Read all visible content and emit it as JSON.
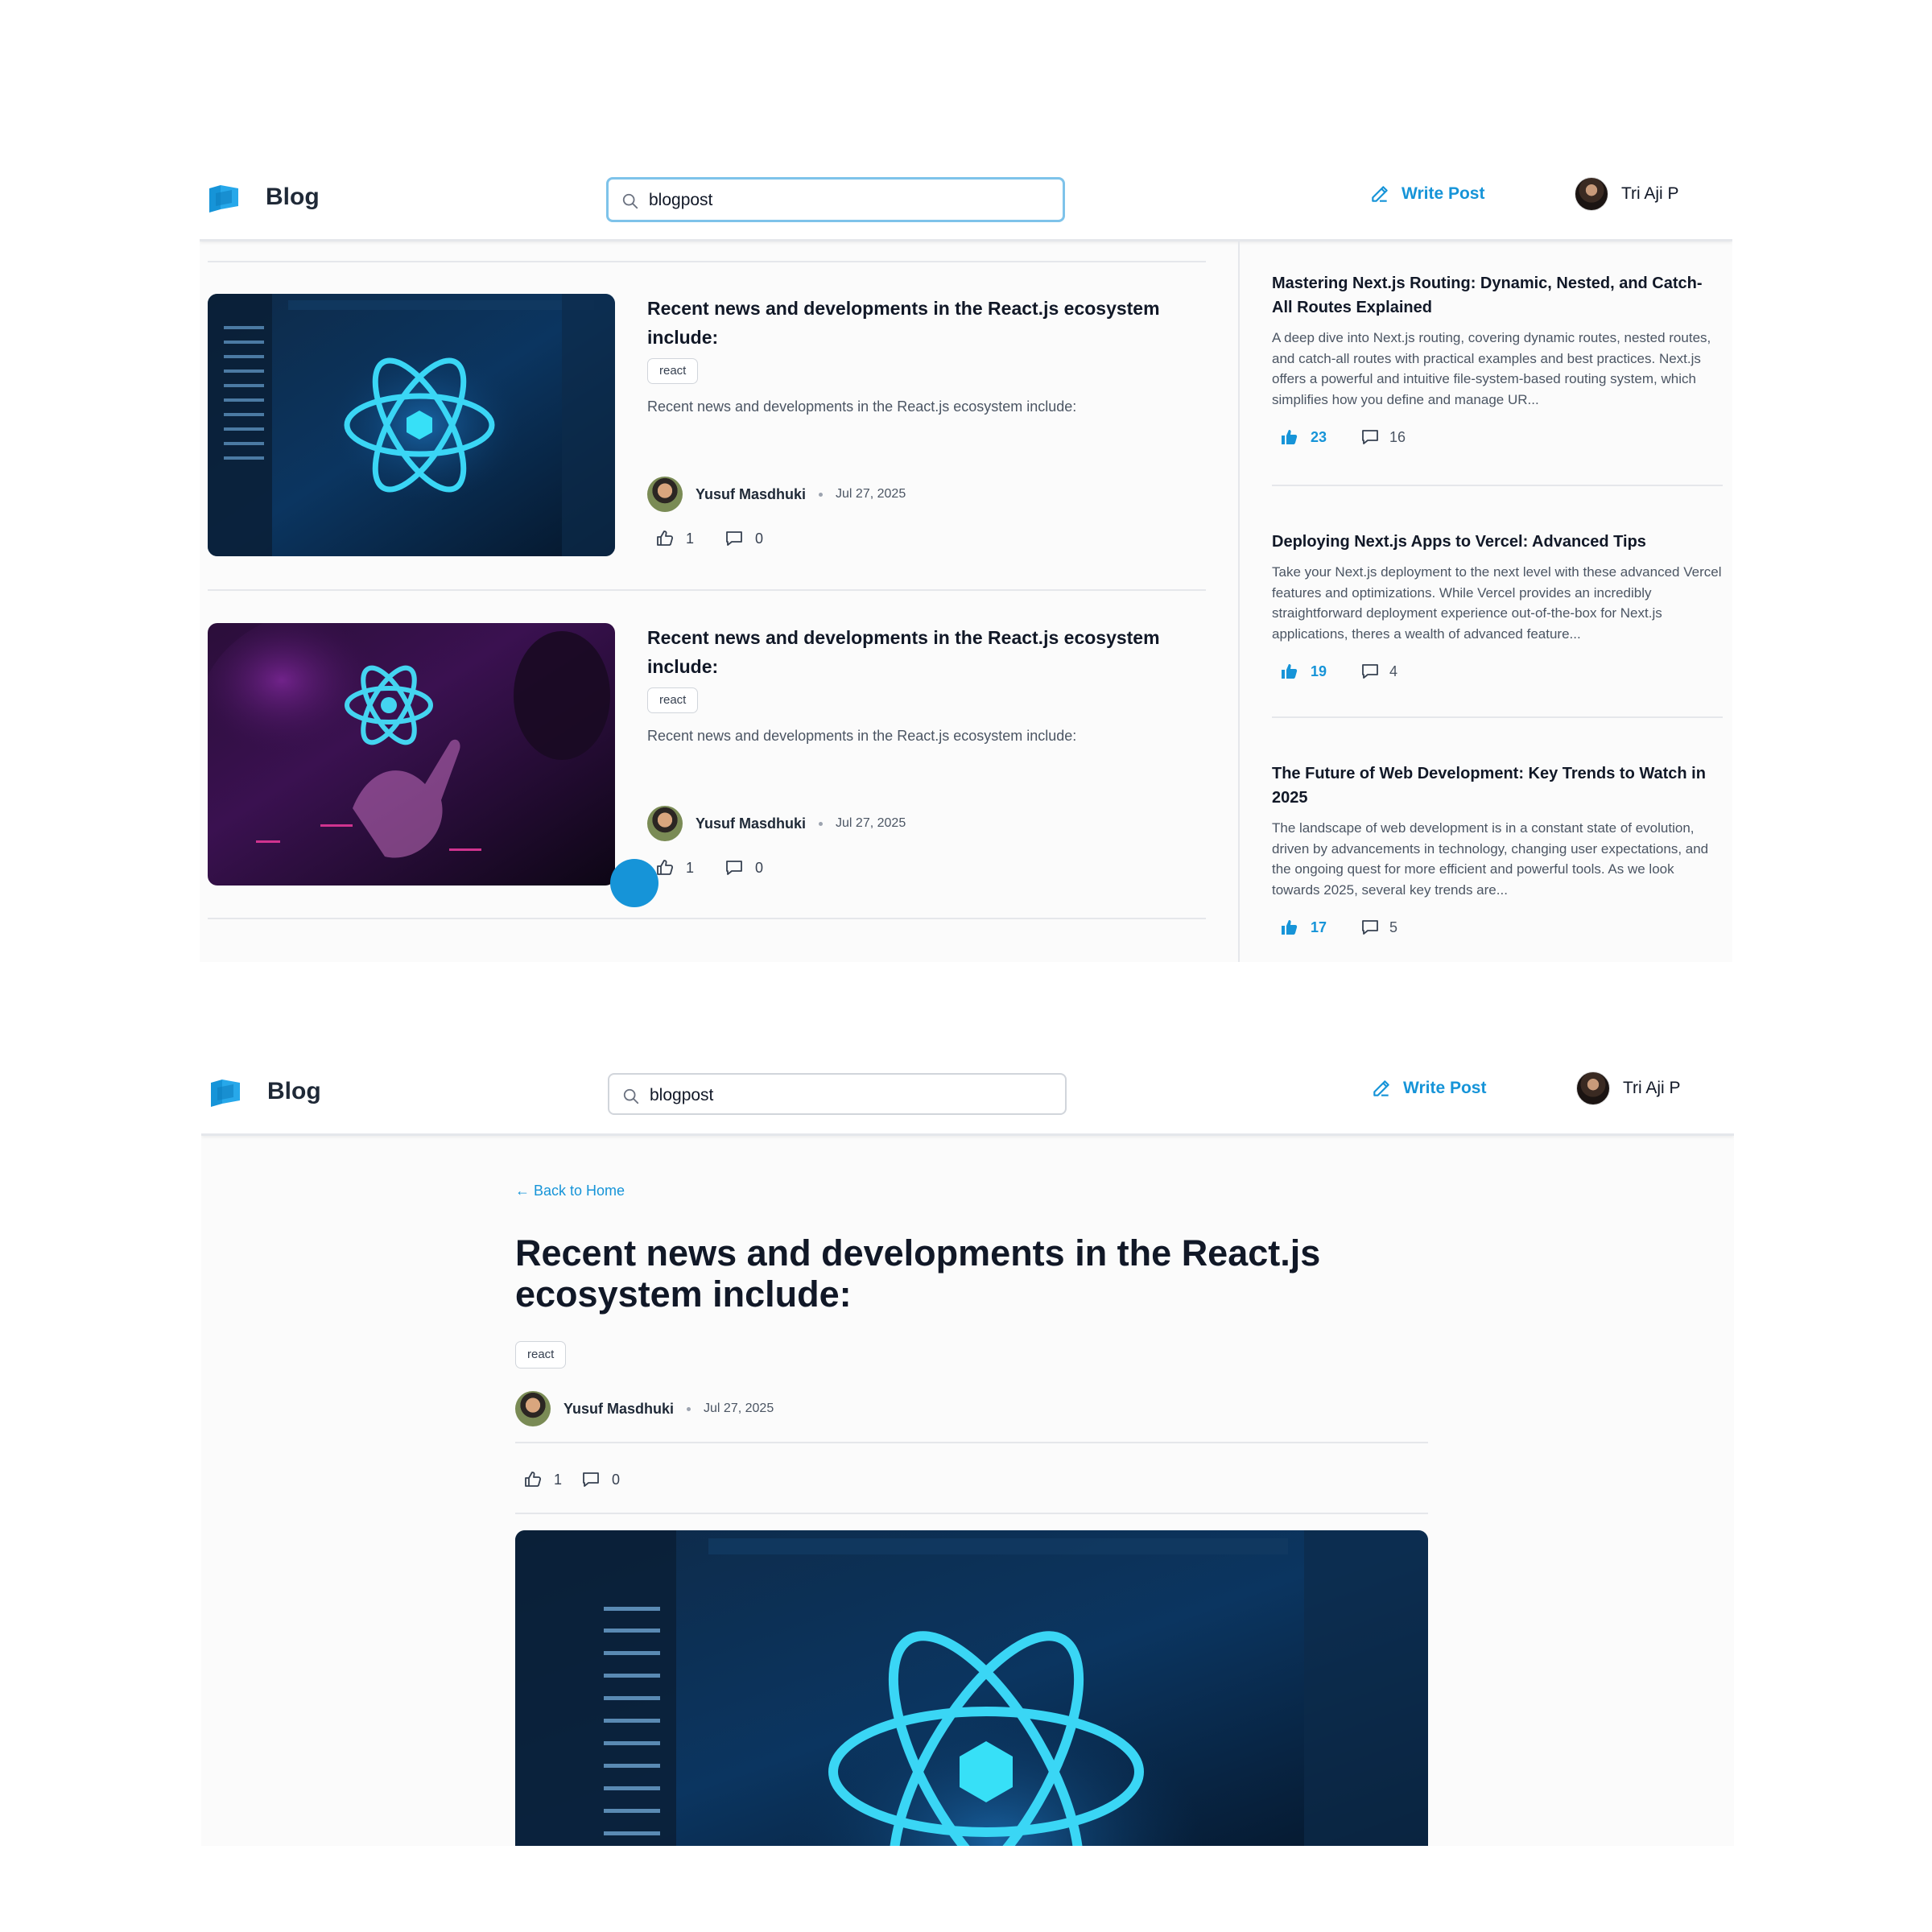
{
  "header": {
    "brand": "Blog",
    "search_value": "blogpost",
    "write_label": "Write Post",
    "user_name": "Tri Aji P",
    "accent_color": "#1694d8"
  },
  "feed": {
    "posts": [
      {
        "title": "Recent news and developments in the React.js ecosystem include:",
        "tag": "react",
        "excerpt": "Recent news and developments in the React.js ecosystem include:",
        "author": "Yusuf Masdhuki",
        "date": "Jul 27, 2025",
        "likes": "1",
        "comments": "0"
      },
      {
        "title": "Recent news and developments in the React.js ecosystem include:",
        "tag": "react",
        "excerpt": "Recent news and developments in the React.js ecosystem include:",
        "author": "Yusuf Masdhuki",
        "date": "Jul 27, 2025",
        "likes": "1",
        "comments": "0"
      }
    ]
  },
  "sidebar": {
    "posts": [
      {
        "title": "Mastering Next.js Routing: Dynamic, Nested, and Catch-All Routes Explained",
        "excerpt": "A deep dive into Next.js routing, covering dynamic routes, nested routes, and catch-all routes with practical examples and best practices. Next.js offers a powerful and intuitive file-system-based routing system, which simplifies how you define and manage UR...",
        "likes": "23",
        "comments": "16"
      },
      {
        "title": "Deploying Next.js Apps to Vercel: Advanced Tips",
        "excerpt": "Take your Next.js deployment to the next level with these advanced Vercel features and optimizations. While Vercel provides an incredibly straightforward deployment experience out-of-the-box for Next.js applications, theres a wealth of advanced feature...",
        "likes": "19",
        "comments": "4"
      },
      {
        "title": "The Future of Web Development: Key Trends to Watch in 2025",
        "excerpt": "The landscape of web development is in a constant state of evolution, driven by advancements in technology, changing user expectations, and the ongoing quest for more efficient and powerful tools. As we look towards 2025, several key trends are...",
        "likes": "17",
        "comments": "5"
      }
    ]
  },
  "detail": {
    "back_label": "← Back to Home",
    "title": "Recent news and developments in the React.js ecosystem include:",
    "tag": "react",
    "author": "Yusuf Masdhuki",
    "date": "Jul 27, 2025",
    "likes": "1",
    "comments": "0"
  }
}
